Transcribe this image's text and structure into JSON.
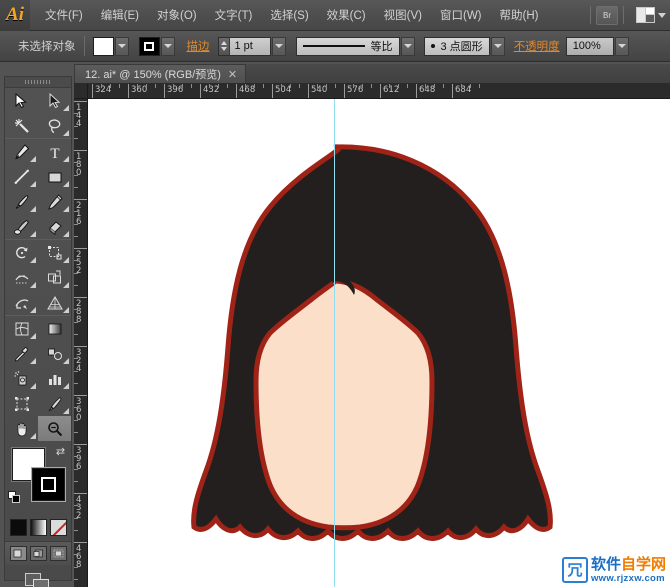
{
  "app": {
    "name": "Adobe Illustrator",
    "logo_text": "Ai"
  },
  "menubar": {
    "items": [
      {
        "label": "文件(F)",
        "name": "menu-file"
      },
      {
        "label": "编辑(E)",
        "name": "menu-edit"
      },
      {
        "label": "对象(O)",
        "name": "menu-object"
      },
      {
        "label": "文字(T)",
        "name": "menu-type"
      },
      {
        "label": "选择(S)",
        "name": "menu-select"
      },
      {
        "label": "效果(C)",
        "name": "menu-effect"
      },
      {
        "label": "视图(V)",
        "name": "menu-view"
      },
      {
        "label": "窗口(W)",
        "name": "menu-window"
      },
      {
        "label": "帮助(H)",
        "name": "menu-help"
      }
    ],
    "bridge_button_label": "Br",
    "workspace_switcher_label": ""
  },
  "controlbar": {
    "selection_status": "未选择对象",
    "fill_color": "#ffffff",
    "stroke_color": "#000000",
    "stroke_link_label": "描边",
    "stroke_weight": "1 pt",
    "profile_label": "等比",
    "brush_label": "3 点圆形",
    "opacity_link_label": "不透明度",
    "opacity_value": "100%"
  },
  "document": {
    "tab_title": "12. ai* @ 150% (RGB/预览)",
    "tab_close": "✕",
    "zoom_level": "150%",
    "color_mode": "RGB",
    "view_mode": "预览"
  },
  "rulers": {
    "horizontal_ticks": [
      "324",
      "360",
      "396",
      "432",
      "468",
      "504",
      "540",
      "576",
      "612",
      "648",
      "684"
    ],
    "vertical_ticks": [
      "144",
      "180",
      "216",
      "252",
      "288",
      "324",
      "360",
      "396",
      "432",
      "468"
    ],
    "unit_spacing_px": 36
  },
  "tools": [
    {
      "name": "selection-tool",
      "label": "选择工具",
      "selected": false
    },
    {
      "name": "direct-selection-tool",
      "label": "直接选择工具",
      "selected": false
    },
    {
      "name": "magic-wand-tool",
      "label": "魔棒工具",
      "selected": false
    },
    {
      "name": "lasso-tool",
      "label": "套索工具",
      "selected": false
    },
    {
      "name": "pen-tool",
      "label": "钢笔工具",
      "selected": false
    },
    {
      "name": "type-tool",
      "label": "文字工具",
      "selected": false
    },
    {
      "name": "line-segment-tool",
      "label": "直线段工具",
      "selected": false
    },
    {
      "name": "rectangle-tool",
      "label": "矩形工具",
      "selected": false
    },
    {
      "name": "paintbrush-tool",
      "label": "画笔工具",
      "selected": false
    },
    {
      "name": "pencil-tool",
      "label": "铅笔工具",
      "selected": false
    },
    {
      "name": "blob-brush-tool",
      "label": "斑点画笔工具",
      "selected": false
    },
    {
      "name": "eraser-tool",
      "label": "橡皮擦工具",
      "selected": false
    },
    {
      "name": "rotate-tool",
      "label": "旋转工具",
      "selected": false
    },
    {
      "name": "scale-tool",
      "label": "比例缩放工具",
      "selected": false
    },
    {
      "name": "width-tool",
      "label": "宽度工具",
      "selected": false
    },
    {
      "name": "free-transform-tool",
      "label": "自由变换工具",
      "selected": false
    },
    {
      "name": "shape-builder-tool",
      "label": "形状生成器工具",
      "selected": false
    },
    {
      "name": "perspective-grid-tool",
      "label": "透视网格工具",
      "selected": false
    },
    {
      "name": "mesh-tool",
      "label": "网格工具",
      "selected": false
    },
    {
      "name": "gradient-tool",
      "label": "渐变工具",
      "selected": false
    },
    {
      "name": "eyedropper-tool",
      "label": "吸管工具",
      "selected": false
    },
    {
      "name": "blend-tool",
      "label": "混合工具",
      "selected": false
    },
    {
      "name": "symbol-sprayer-tool",
      "label": "符号喷枪工具",
      "selected": false
    },
    {
      "name": "column-graph-tool",
      "label": "柱形图工具",
      "selected": false
    },
    {
      "name": "artboard-tool",
      "label": "画板工具",
      "selected": false
    },
    {
      "name": "slice-tool",
      "label": "切片工具",
      "selected": false
    },
    {
      "name": "hand-tool",
      "label": "抓手工具",
      "selected": false
    },
    {
      "name": "zoom-tool",
      "label": "缩放工具",
      "selected": true
    }
  ],
  "color_controls": {
    "fill_color": "#ffffff",
    "stroke_color": "#000000",
    "swap_icon": "⇄",
    "modes": [
      {
        "name": "color-mode-button",
        "label": "颜色"
      },
      {
        "name": "gradient-mode-button",
        "label": "渐变"
      },
      {
        "name": "none-mode-button",
        "label": "无"
      }
    ],
    "draw_modes": [
      {
        "name": "draw-normal-button",
        "label": "正常绘图",
        "active": true
      },
      {
        "name": "draw-behind-button",
        "label": "背面绘图",
        "active": false
      },
      {
        "name": "draw-inside-button",
        "label": "内部绘图",
        "active": false
      }
    ],
    "screen_mode_label": "更改屏幕模式"
  },
  "artwork": {
    "title": "卡通人物头发与脸部",
    "hair_fill": "#231f1e",
    "hair_stroke": "#a02318",
    "face_fill": "#fbdfc8",
    "face_stroke": "#a02318",
    "stroke_width": "5",
    "guide_color": "#8fdff0",
    "background": "#ffffff"
  },
  "watermark": {
    "mark_glyph": "冗",
    "title_blue": "软件",
    "title_orange": "自学网",
    "url": "www.rjzxw.com",
    "blue": "#1a6fc4",
    "orange": "#f07c00"
  }
}
